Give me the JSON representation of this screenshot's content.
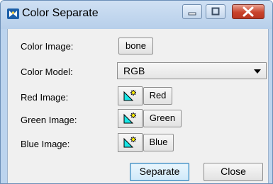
{
  "window": {
    "title": "Color Separate",
    "icon": "app-logo-icon",
    "controls": {
      "minimize": "minimize-icon",
      "maximize": "maximize-icon",
      "close": "close-icon"
    }
  },
  "form": {
    "color_image": {
      "label": "Color Image:",
      "button": "bone"
    },
    "color_model": {
      "label": "Color Model:",
      "value": "RGB"
    },
    "red_image": {
      "label": "Red Image:",
      "button": "Red",
      "icon": "new-image-icon"
    },
    "green_image": {
      "label": "Green Image:",
      "button": "Green",
      "icon": "new-image-icon"
    },
    "blue_image": {
      "label": "Blue Image:",
      "button": "Blue",
      "icon": "new-image-icon"
    }
  },
  "actions": {
    "separate": "Separate",
    "close": "Close"
  },
  "colors": {
    "titlebar": "#c3d8ef",
    "close_button": "#c7432b",
    "new_image_icon": "#19e6e6",
    "primary_border": "#3c7fb1"
  }
}
